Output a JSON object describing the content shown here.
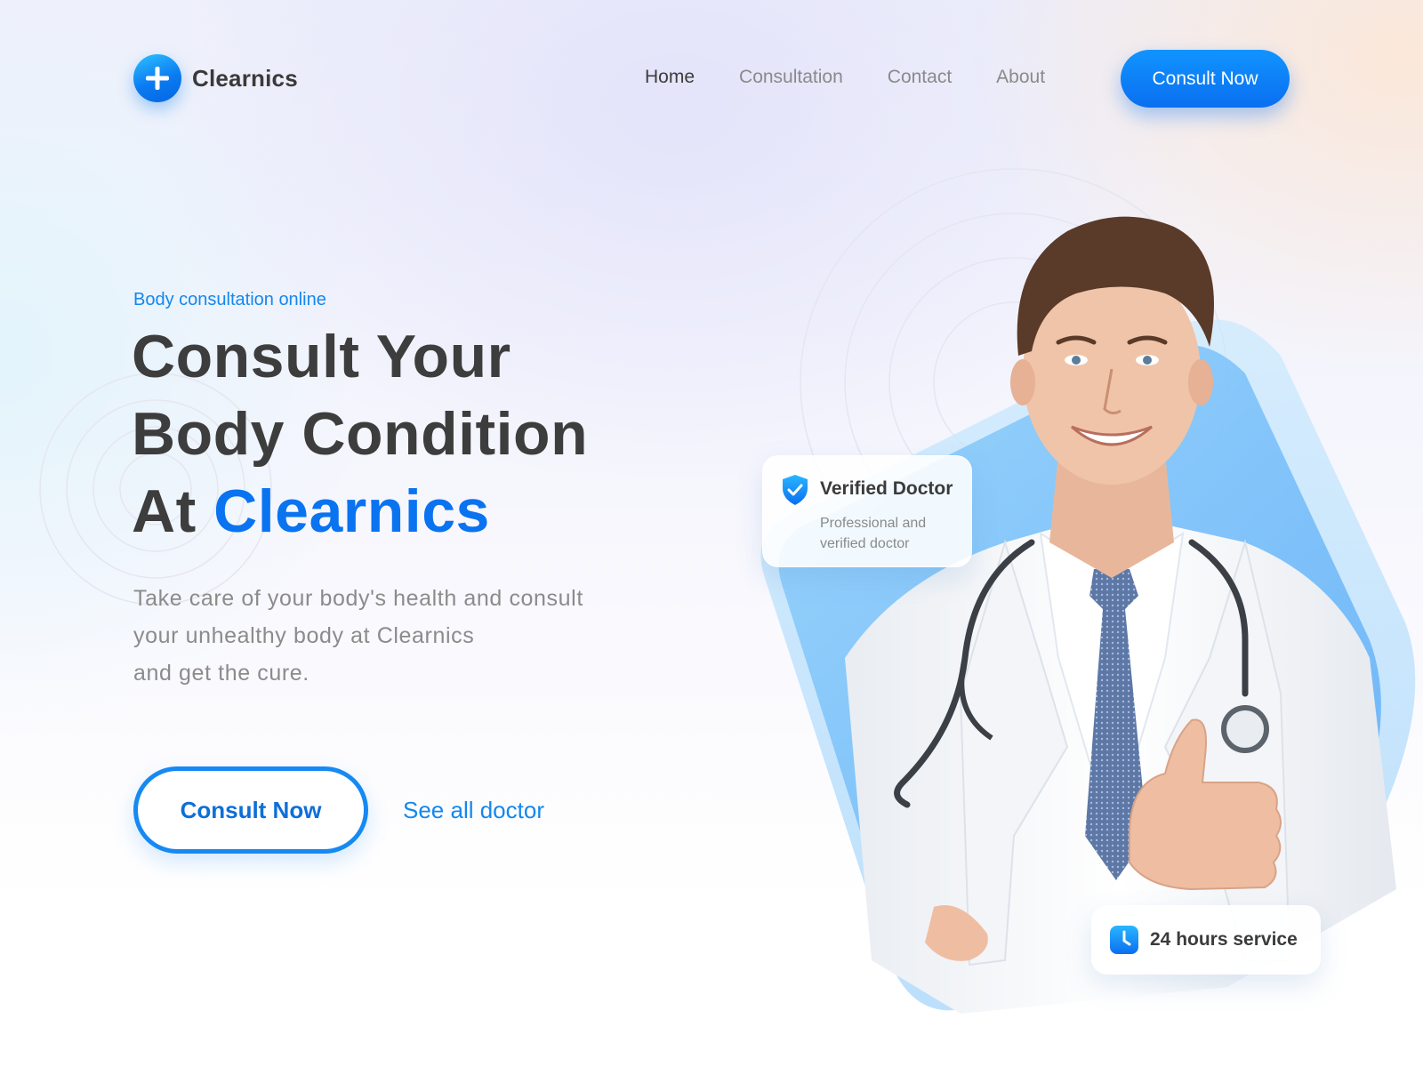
{
  "brand": {
    "name": "Clearnics",
    "logo_icon": "plus-icon",
    "primary_color": "#0a73f0",
    "accent_light": "#2ec1ff"
  },
  "nav": {
    "items": [
      {
        "label": "Home",
        "active": true
      },
      {
        "label": "Consultation",
        "active": false
      },
      {
        "label": "Contact",
        "active": false
      },
      {
        "label": "About",
        "active": false
      }
    ],
    "cta_label": "Consult Now"
  },
  "hero": {
    "kicker": "Body consultation online",
    "headline_line1": "Consult Your",
    "headline_line2": "Body Condition",
    "headline_line3_prefix": "At",
    "headline_line3_accent": "Clearnics",
    "description_line1": "Take care of your body's health and consult",
    "description_line2": "your unhealthy body at Clearnics",
    "description_line3": "and get the cure.",
    "primary_button": "Consult Now",
    "secondary_link": "See all doctor"
  },
  "badges": {
    "verified": {
      "icon": "shield-check-icon",
      "title": "Verified Doctor",
      "subtitle": "Professional and verified doctor"
    },
    "service": {
      "icon": "clock-icon",
      "label": "24 hours service"
    }
  },
  "hero_image": {
    "subject": "doctor-photo"
  }
}
